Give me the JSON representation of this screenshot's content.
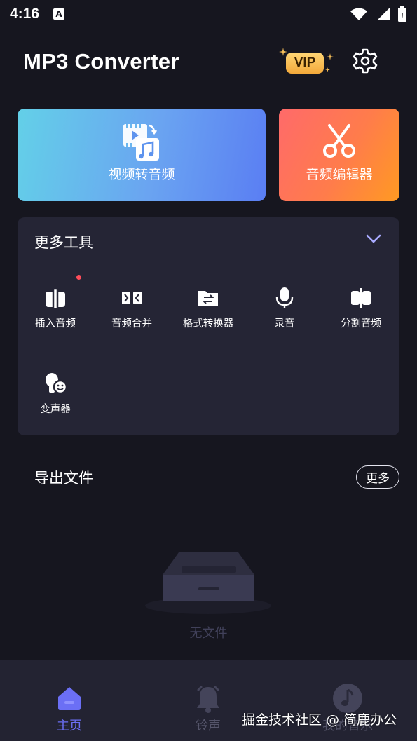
{
  "status_bar": {
    "time": "4:16",
    "notification_glyph": "A"
  },
  "header": {
    "title": "MP3 Converter",
    "vip_label": "VIP"
  },
  "cards": {
    "video_to_audio": "视频转音频",
    "audio_editor": "音频编辑器"
  },
  "tools": {
    "title": "更多工具",
    "items": [
      {
        "label": "插入音频",
        "icon": "insert-audio-icon",
        "badge": true
      },
      {
        "label": "音频合并",
        "icon": "merge-audio-icon",
        "badge": false
      },
      {
        "label": "格式转换器",
        "icon": "format-converter-icon",
        "badge": false
      },
      {
        "label": "录音",
        "icon": "microphone-icon",
        "badge": false
      },
      {
        "label": "分割音频",
        "icon": "split-audio-icon",
        "badge": false
      },
      {
        "label": "变声器",
        "icon": "voice-changer-icon",
        "badge": false
      }
    ]
  },
  "exports": {
    "title": "导出文件",
    "more_label": "更多",
    "empty_text": "无文件"
  },
  "bottom_nav": {
    "items": [
      {
        "label": "主页",
        "icon": "home-icon",
        "active": true
      },
      {
        "label": "铃声",
        "icon": "bell-icon",
        "active": false
      },
      {
        "label": "我的音乐",
        "icon": "music-note-icon",
        "active": false
      }
    ]
  },
  "watermark": "掘金技术社区 @ 简鹿办公",
  "colors": {
    "accent": "#6b6ff5",
    "background": "#16161f",
    "panel": "#252535",
    "badge": "#ff4d5a"
  }
}
